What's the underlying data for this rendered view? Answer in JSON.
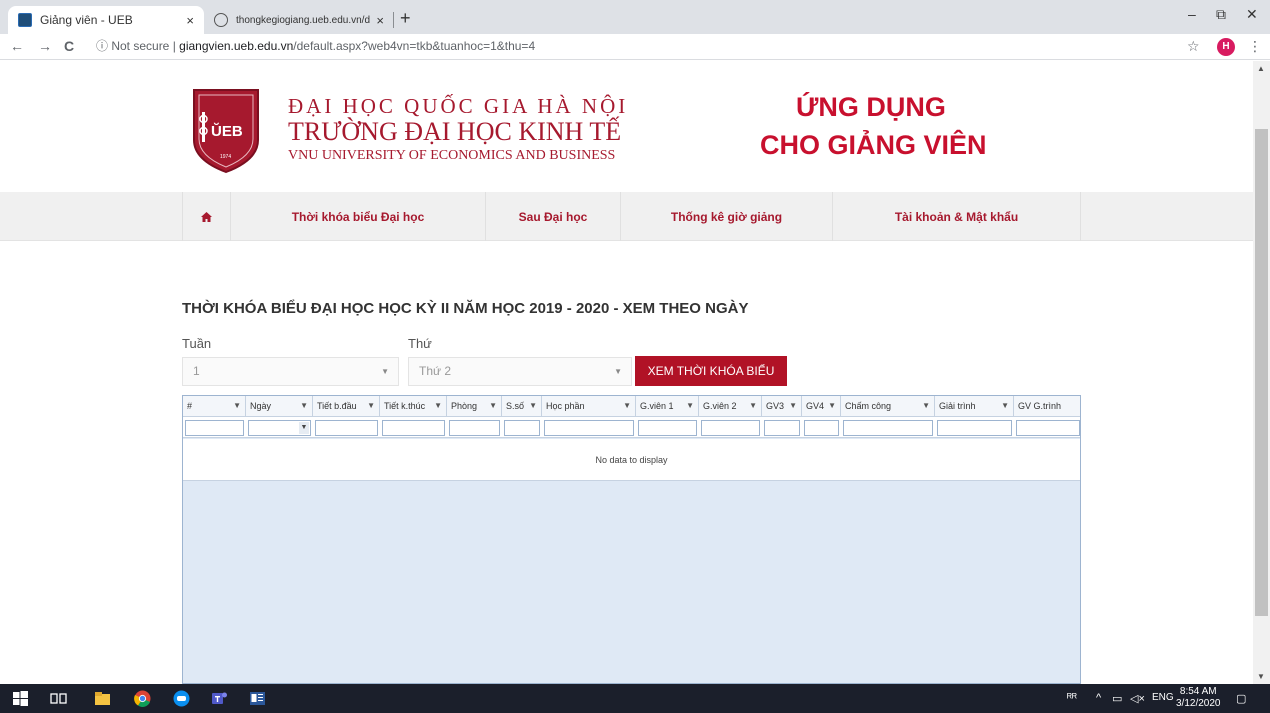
{
  "browser": {
    "tabs": [
      {
        "title": "Giảng viên - UEB",
        "active": true
      },
      {
        "title": "thongkegiogiang.ueb.edu.vn/de",
        "active": false
      }
    ],
    "new_tab": "+",
    "close_glyph": "×",
    "window_controls": [
      "–",
      "⧉",
      "✕"
    ],
    "nav": {
      "back": "←",
      "forward": "→",
      "reload": "C"
    },
    "security": "ⓘ Not secure",
    "url_host": "giangvien.ueb.edu.vn",
    "url_path": "/default.aspx?web4vn=tkb&tuanhoc=1&thu=4",
    "profile_initial": "H"
  },
  "header": {
    "crest_text": "ŬEB",
    "crest_year": "1974",
    "university_line1": "ĐẠI HỌC QUỐC GIA HÀ NỘI",
    "university_line2": "TRƯỜNG ĐẠI HỌC KINH TẾ",
    "university_line3": "VNU UNIVERSITY OF ECONOMICS AND BUSINESS",
    "app_title_line1": "ỨNG DỤNG",
    "app_title_line2": "CHO GIẢNG VIÊN"
  },
  "nav": {
    "home_icon": "home-icon",
    "items": [
      "Thời khóa biểu Đại học",
      "Sau Đại học",
      "Thống kê giờ giảng",
      "Tài khoản & Mật khẩu"
    ]
  },
  "main": {
    "heading": "THỜI KHÓA BIỂU ĐẠI HỌC HỌC KỲ II NĂM HỌC 2019 - 2020 - XEM THEO NGÀY",
    "week_label": "Tuần",
    "week_value": "1",
    "day_label": "Thứ",
    "day_value": "Thứ 2",
    "view_button": "XEM THỜI KHÓA BIỂU"
  },
  "grid": {
    "columns": [
      "#",
      "Ngày",
      "Tiết b.đầu",
      "Tiết k.thúc",
      "Phòng",
      "S.số",
      "Học phần",
      "G.viên 1",
      "G.viên 2",
      "GV3",
      "GV4",
      "Chấm công",
      "Giải trình",
      "GV G.trình"
    ],
    "empty_text": "No data to display"
  },
  "taskbar": {
    "tray": "ENG",
    "time": "8:54 AM",
    "date": "3/12/2020"
  },
  "colors": {
    "brand": "#a6192e",
    "button": "#b11226",
    "grid_bg": "#dfe9f5",
    "taskbar": "#1b1f2b"
  }
}
